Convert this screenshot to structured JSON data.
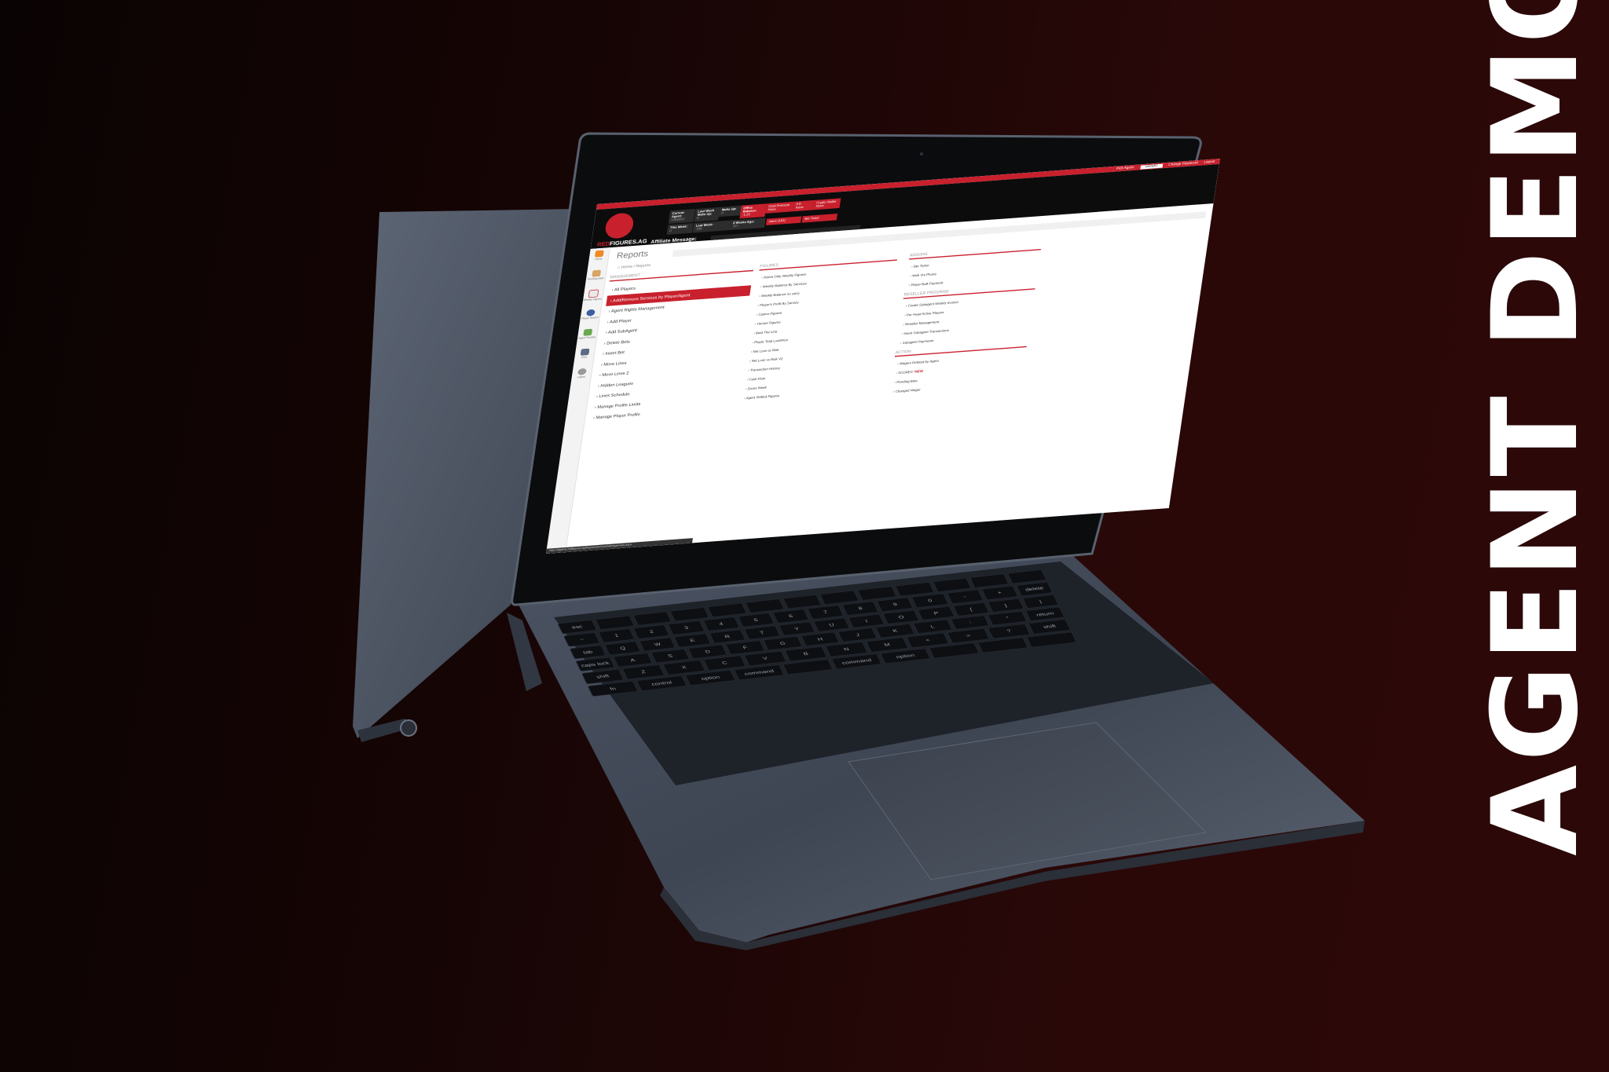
{
  "side_title": "AGENT DEMO",
  "colors": {
    "brand_red": "#c8202d",
    "header_bg": "#0c0c0c",
    "bg_dark": "#0a0303",
    "bg_red": "#2d0808"
  },
  "topbar": {
    "pick_agent_label": "Pick Agent:",
    "pick_agent_value": "UAGENT",
    "change_password": "Change Password",
    "logout": "Logout"
  },
  "logo": {
    "red": "RED",
    "rest": "FIGURES.AG"
  },
  "header_stats": {
    "current_agent": {
      "label": "Current Agent:",
      "value": "UAGENT"
    },
    "last_week_makeup": {
      "label": "Last Week Make Up:",
      "value": "0"
    },
    "makeup": {
      "label": "Make Up:",
      "value": "0"
    },
    "office_balance": {
      "label": "Office Balance:",
      "value": "-1,13"
    },
    "card_premium": {
      "label": "Card Premium",
      "value": "None"
    },
    "pph": {
      "label": "P.P.",
      "value": "None"
    },
    "crypto_wallet": {
      "label": "Crypto Wallet",
      "value": "None"
    },
    "this_week": {
      "label": "This Week:",
      "value": "0"
    },
    "last_week": {
      "label": "Last Week:",
      "value": "-106"
    },
    "two_weeks_ago": {
      "label": "2 Weeks Ago:",
      "value": "717"
    },
    "inbox": "Inbox (181)",
    "bet_ticker": "Bet Ticker"
  },
  "affiliate_message_label": "Affiliate Message:",
  "sidebar": {
    "items": [
      "Home",
      "Pending Bets",
      "Weekly Figures",
      "Player Search",
      "Agent Position",
      "Print",
      "Logout"
    ]
  },
  "page": {
    "title": "Reports",
    "breadcrumb": [
      "Home",
      "Reports"
    ]
  },
  "management": {
    "header": "Management",
    "items": [
      "All Players",
      "Add/Remove Services by Player/Agent",
      "Agent Rights Management",
      "Add Player",
      "Add SubAgent",
      "Delete Bets",
      "Insert Bet",
      "Move Lines",
      "Move Lines 2",
      "Hidden Leagues",
      "Lines Schedule",
      "Manage Profile Limits",
      "Manage Player Profile"
    ],
    "active_index": 1
  },
  "figures": {
    "header": "Figures",
    "items": [
      "Active Only Weekly Figures",
      "Weekly Balance By Services",
      "Weekly Balance no carry",
      "Player's Profit By Service",
      "Casino Figures",
      "Horses Figures",
      "Beat The Line",
      "Player Total Lost/Won",
      "Net Loss vs Risk",
      "Net Loss vs Risk V2",
      "Transaction History",
      "Cash Flow",
      "Gross Week",
      "Agent Settled Figures"
    ]
  },
  "addons": {
    "header": "Addons",
    "items": [
      "Bet Ticker",
      "Web Vrs Phone",
      "Player Bulk Payment"
    ]
  },
  "reseller": {
    "header": "Reseller Program",
    "items": [
      "Create Subagent Weekly Invoice",
      "Per Head Active Players",
      "Reseller Management",
      "Insert Subagent Transactions",
      "Subagent Payments"
    ]
  },
  "action": {
    "header": "Action",
    "items": [
      "Wagers Deleted by Agent",
      "SCORES",
      "Pending Bets",
      "Changed Wager"
    ],
    "new_badge": "*NEW"
  },
  "status_url": "https://agents.redfigures.ag/Report/ServicesManagement.aspx",
  "keyboard": {
    "rows": [
      [
        "esc",
        "",
        "",
        "",
        "",
        "",
        "",
        "",
        "",
        "",
        "",
        "",
        ""
      ],
      [
        "~",
        "1",
        "2",
        "3",
        "4",
        "5",
        "6",
        "7",
        "8",
        "9",
        "0",
        "-",
        "+",
        "delete"
      ],
      [
        "tab",
        "Q",
        "W",
        "E",
        "R",
        "T",
        "Y",
        "U",
        "I",
        "O",
        "P",
        "{",
        "}",
        "|"
      ],
      [
        "caps lock",
        "A",
        "S",
        "D",
        "F",
        "G",
        "H",
        "J",
        "K",
        "L",
        ":",
        "\"",
        "return"
      ],
      [
        "shift",
        "Z",
        "X",
        "C",
        "V",
        "B",
        "N",
        "M",
        "<",
        ">",
        "?",
        "shift"
      ],
      [
        "fn",
        "control",
        "option",
        "command",
        "",
        "command",
        "option",
        "",
        "",
        ""
      ]
    ]
  }
}
